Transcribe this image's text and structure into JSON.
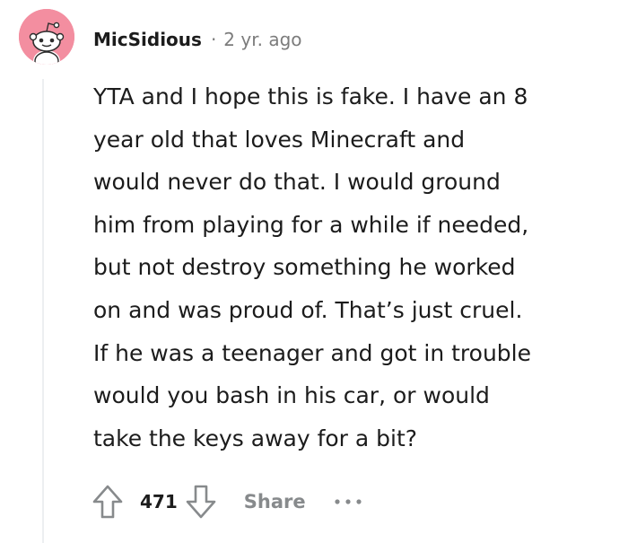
{
  "comment": {
    "author": "MicSidious",
    "separator": "·",
    "timestamp": "2 yr. ago",
    "body_lines": [
      "YTA and I hope this is fake. I have an 8",
      "year old that loves Minecraft and",
      "would never do that. I would ground",
      "him from playing for a while if needed,",
      "but not destroy something he worked",
      "on and was proud of. That’s just cruel.",
      "If he was a teenager and got in trouble",
      "would you bash in his car, or would",
      "take the keys away for a bit?"
    ]
  },
  "actions": {
    "vote_count": "471",
    "share_label": "Share",
    "more_label": "•••"
  },
  "icons": {
    "avatar": "snoo-avatar-icon",
    "upvote": "upvote-arrow-icon",
    "downvote": "downvote-arrow-icon",
    "more": "more-options-icon"
  },
  "colors": {
    "avatar_bg": "#f38ea0",
    "text": "#1c1c1c",
    "meta": "#7c7c7c",
    "action": "#878a8c",
    "thread_line": "#edeff1"
  }
}
